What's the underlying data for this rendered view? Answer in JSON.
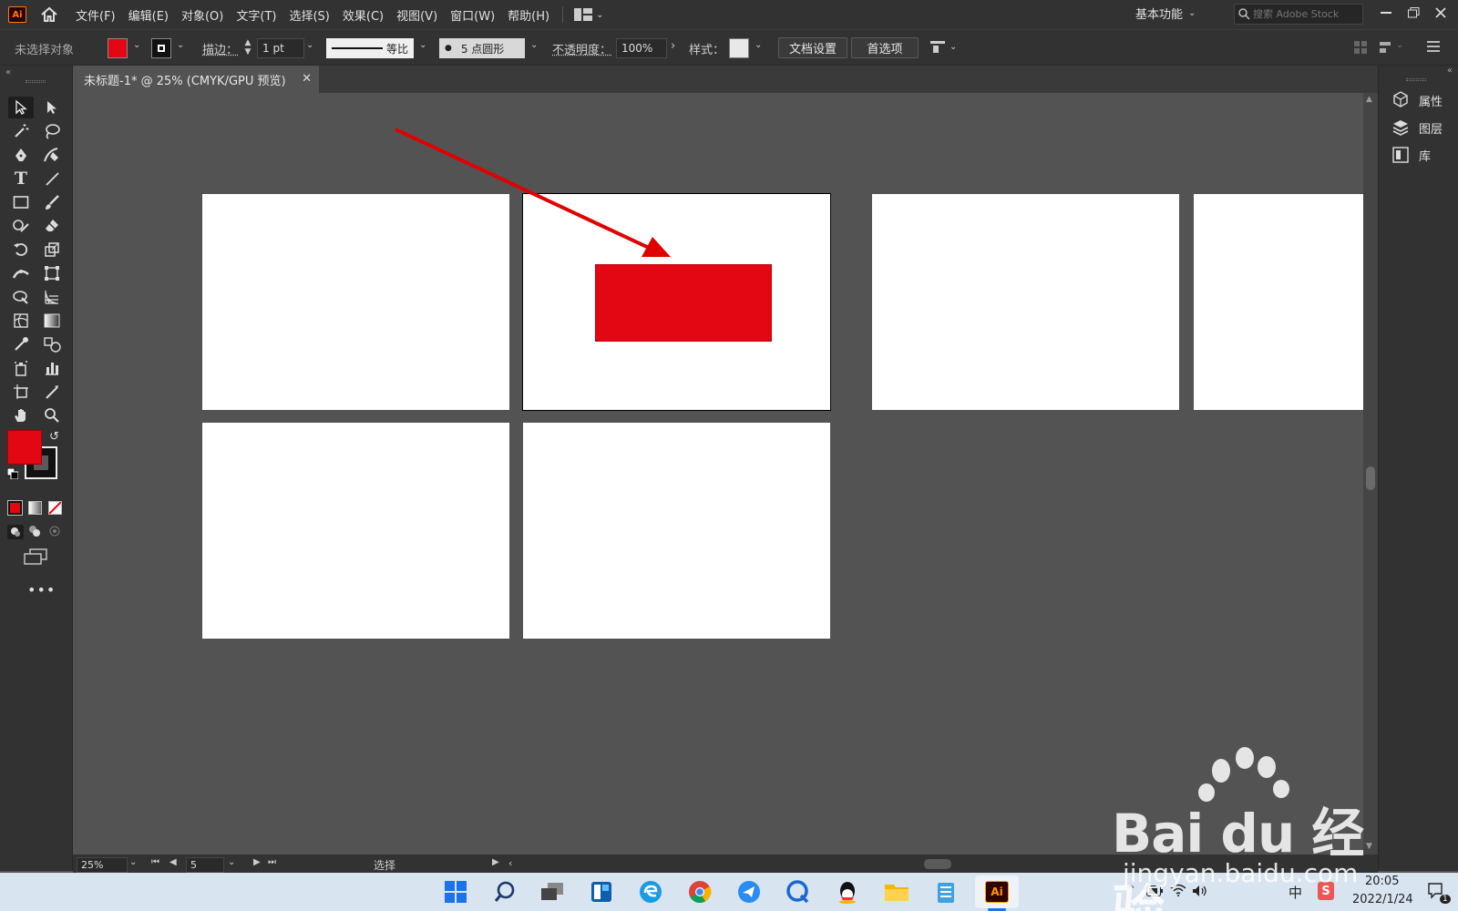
{
  "app": {
    "logo_text": "Ai",
    "menu": [
      "文件(F)",
      "编辑(E)",
      "对象(O)",
      "文字(T)",
      "选择(S)",
      "效果(C)",
      "视图(V)",
      "窗口(W)",
      "帮助(H)"
    ],
    "workspace_label": "基本功能",
    "search_placeholder": "搜索 Adobe Stock"
  },
  "control_bar": {
    "selection_status": "未选择对象",
    "fill_color": "#e30613",
    "stroke_label": "描边：",
    "stroke_weight": "1 pt",
    "stroke_profile": "等比",
    "brush": "5 点圆形",
    "opacity_label": "不透明度：",
    "opacity_value": "100%",
    "style_label": "样式：",
    "doc_setup_button": "文档设置",
    "preferences_button": "首选项"
  },
  "document": {
    "tab_title": "未标题-1* @ 25% (CMYK/GPU 预览)"
  },
  "canvas": {
    "background": "#535353",
    "artboard_color": "#ffffff",
    "shape_color": "#e30613",
    "arrow_color": "#e00000"
  },
  "right_panel": {
    "items": [
      "属性",
      "图层",
      "库"
    ]
  },
  "status_bar": {
    "zoom": "25%",
    "artboard_number": "5",
    "tool_status": "选择"
  },
  "taskbar": {
    "ime": "中",
    "time": "20:05",
    "date": "2022/1/24",
    "notification_count": "1",
    "active_app": "Ai"
  },
  "watermark": {
    "brand": "Bai du 经验",
    "url": "jingyan.baidu.com"
  }
}
